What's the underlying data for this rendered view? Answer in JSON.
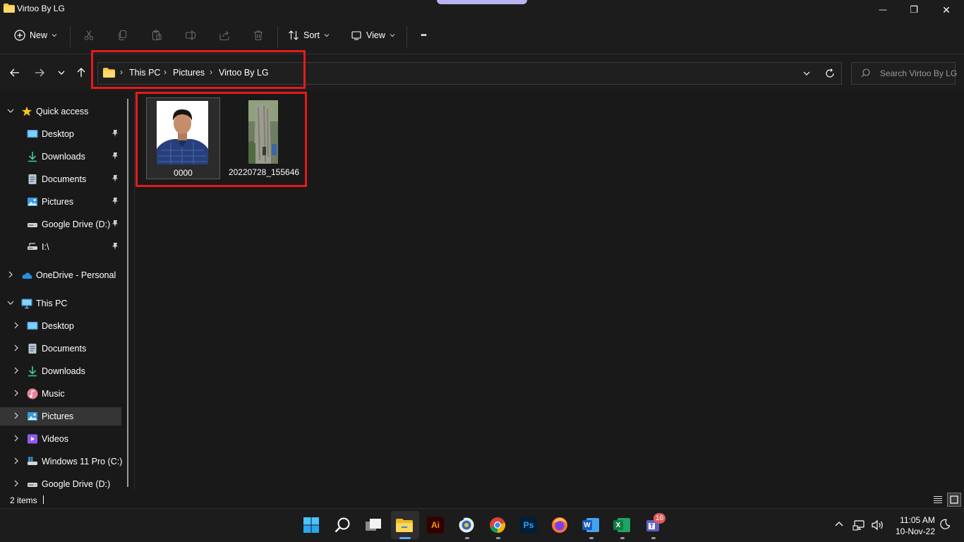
{
  "window": {
    "title": "Virtoo By LG",
    "minimize_glyph": "—",
    "maximize_glyph": "❐",
    "close_glyph": "✕"
  },
  "toolbar": {
    "new_label": "New",
    "sort_label": "Sort",
    "view_label": "View",
    "more_glyph": "•••",
    "icons": [
      "cut-icon",
      "copy-icon",
      "paste-icon",
      "rename-icon",
      "share-icon",
      "delete-icon"
    ]
  },
  "address": {
    "crumbs": [
      "This PC",
      "Pictures",
      "Virtoo By LG"
    ],
    "separator": "›"
  },
  "search": {
    "placeholder": "Search Virtoo By LG"
  },
  "sidebar": {
    "quick_access": {
      "label": "Quick access",
      "items": [
        "Desktop",
        "Downloads",
        "Documents",
        "Pictures",
        "Google Drive (D:)",
        "I:\\"
      ]
    },
    "onedrive": {
      "label": "OneDrive - Personal"
    },
    "this_pc": {
      "label": "This PC",
      "items": [
        "Desktop",
        "Documents",
        "Downloads",
        "Music",
        "Pictures",
        "Videos",
        "Windows 11 Pro (C:)",
        "Google Drive (D:)"
      ],
      "selected": "Pictures"
    }
  },
  "files": [
    {
      "name": "0000",
      "selected": true
    },
    {
      "name": "20220728_155646",
      "selected": false
    }
  ],
  "status": {
    "item_count": "2 items"
  },
  "taskbar": {
    "apps": [
      "windows-start-icon",
      "search-icon",
      "task-view-icon",
      "file-explorer-icon",
      "illustrator-icon",
      "photo-app-icon",
      "chrome-icon",
      "photoshop-icon",
      "firefox-icon",
      "word-icon",
      "excel-icon",
      "teams-icon"
    ],
    "illustrator_text": "Ai",
    "photoshop_text": "Ps",
    "word_text": "W",
    "excel_text": "X",
    "badge_count": "16",
    "clock_time": "11:05 AM",
    "clock_date": "10-Nov-22"
  },
  "colors": {
    "highlight_box": "#e31b1b",
    "folder_yellow": "#f7c948",
    "accent_blue": "#5aa8ff"
  }
}
